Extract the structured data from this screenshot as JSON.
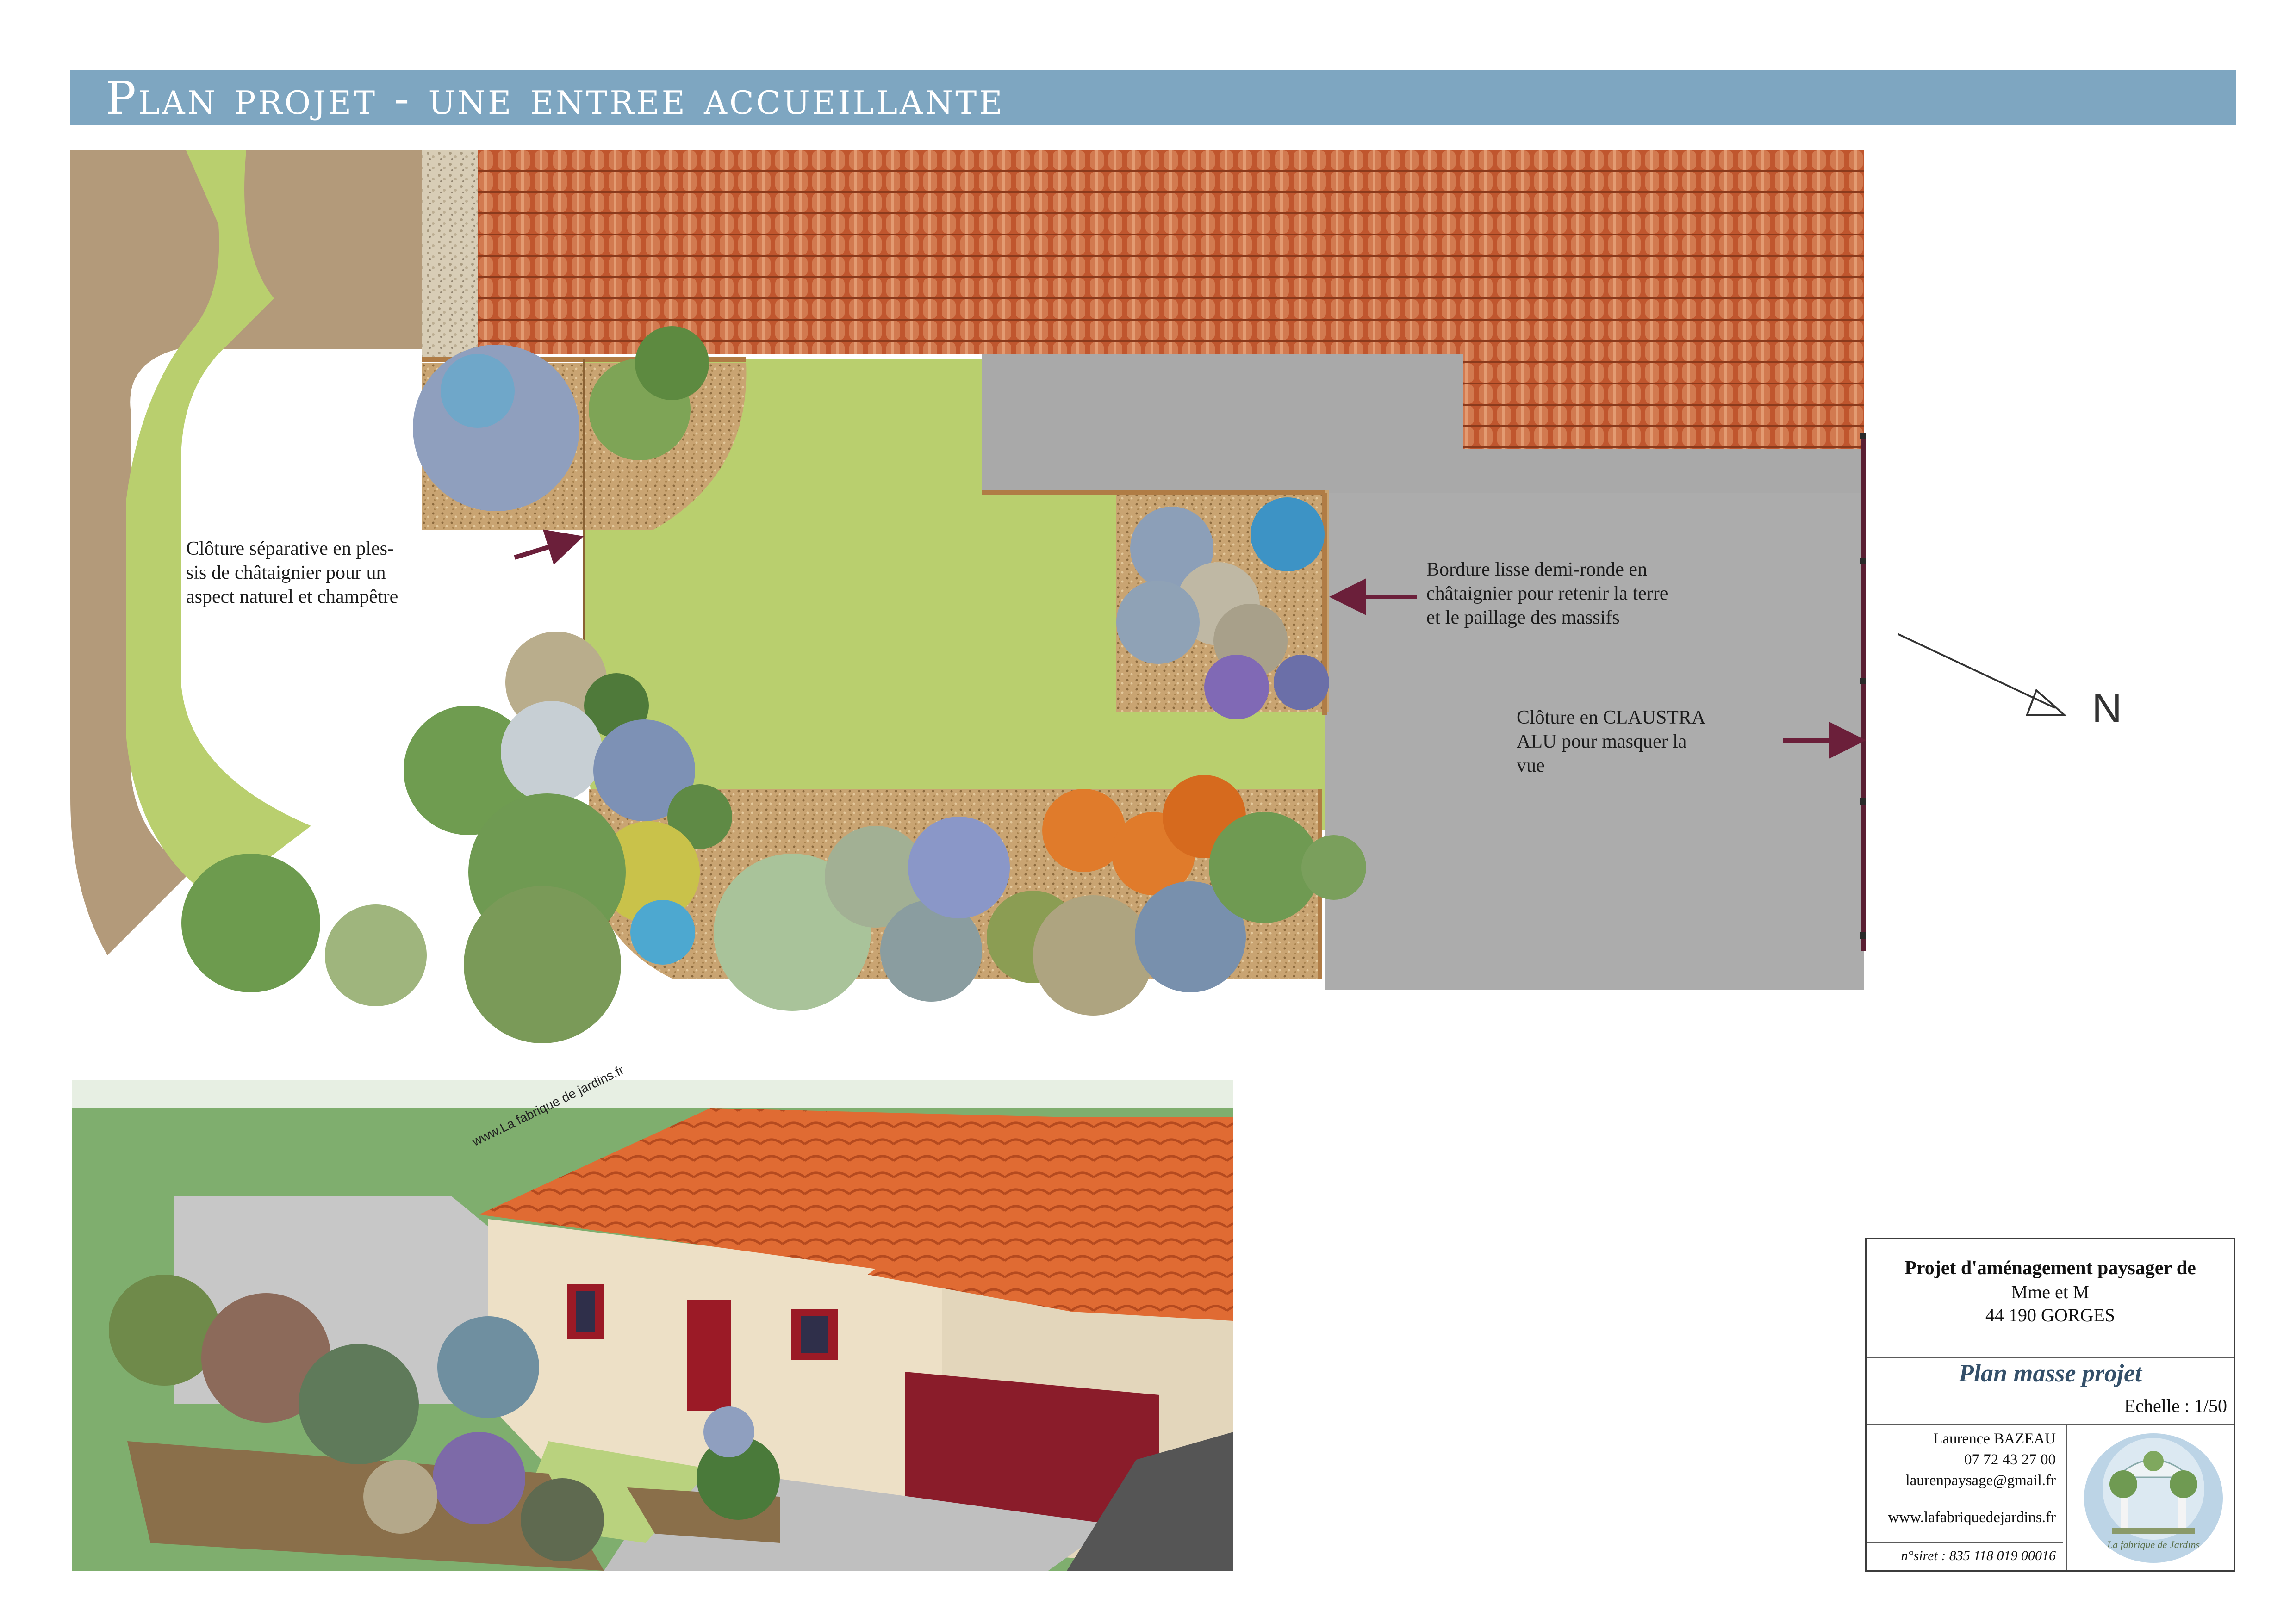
{
  "title": "Plan projet - une entree accueillante",
  "annotations": {
    "cloture_plessis": [
      "Clôture séparative en ples-",
      "sis de châtaignier pour un",
      "aspect naturel et champêtre"
    ],
    "bordure": [
      "Bordure lisse demi-ronde en",
      "châtaignier pour retenir la terre",
      "et le paillage des massifs"
    ],
    "cloture_claustra": [
      "Clôture en CLAUSTRA",
      "ALU pour masquer la",
      "vue"
    ]
  },
  "north_label": "N",
  "view_watermark": "www.La fabrique de jardins.fr",
  "cartouche": {
    "project_title": "Projet d'aménagement paysager de",
    "client": "Mme et M",
    "location": "44 190 GORGES",
    "plan_name": "Plan masse projet",
    "scale": "Echelle : 1/50",
    "designer": "Laurence BAZEAU",
    "phone": "07 72 43 27 00",
    "email": "laurenpaysage@gmail.fr",
    "website": "www.lafabriquedejardins.fr",
    "siret": "n°siret : 835 118 019 00016",
    "logo_text": "La fabrique de Jardins"
  },
  "colors": {
    "title_bar": "#7ea6c1",
    "lawn": "#b9cf6e",
    "gravel": "#b39a7a",
    "roof": "#c8643a",
    "paving": "#a9a9a9",
    "arrow": "#6b1f3a"
  }
}
